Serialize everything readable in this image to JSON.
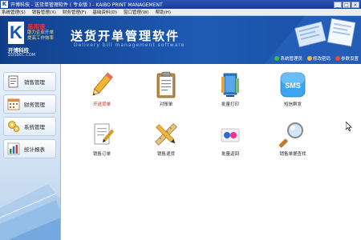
{
  "window": {
    "app_icon": "K",
    "title": "开博科技 - 送货单管理软件 ( 专业版 ) - KAIBO PRINT MANAGEMENT",
    "buttons": [
      "_",
      "□",
      "×"
    ]
  },
  "menubar": [
    "系统管理(S)",
    "销售管理(X)",
    "财务管理(F)",
    "基础资料(D)",
    "窗口管理(W)",
    "帮助(H)"
  ],
  "banner": {
    "logo_letter": "K",
    "brand_red": "易用速",
    "slogan_1": "助力企业开单",
    "slogan_2": "提高工作效率",
    "company": "开博科技",
    "site": "ZOSBEC.COM",
    "main_title": "送货开单管理软件",
    "sub_title": "Delivery bill management software",
    "links": [
      {
        "label": "系统管理员",
        "icon": "user-icon",
        "color": "#2fbf4a"
      },
      {
        "label": "修改密码",
        "icon": "key-icon",
        "color": "#f2b630"
      },
      {
        "label": "参数设置",
        "icon": "settings-icon",
        "color": "#e94b3c"
      }
    ]
  },
  "sidebar": {
    "items": [
      {
        "label": "销售管理",
        "icon": "document-icon"
      },
      {
        "label": "财务管理",
        "icon": "calendar-icon"
      },
      {
        "label": "系统管理",
        "icon": "gears-icon"
      },
      {
        "label": "统计报表",
        "icon": "bar-chart-icon"
      }
    ]
  },
  "tiles": [
    {
      "label": "开送货单",
      "icon": "pencil-icon",
      "highlight": true
    },
    {
      "label": "对账单",
      "icon": "clipboard-icon",
      "highlight": false
    },
    {
      "label": "批量打印",
      "icon": "print-icon",
      "highlight": false
    },
    {
      "label": "短信群发",
      "icon": "sms-icon",
      "highlight": false
    },
    {
      "label": "销售订单",
      "icon": "order-icon",
      "highlight": false
    },
    {
      "label": "销售退货",
      "icon": "return-icon",
      "highlight": false
    },
    {
      "label": "批量返回",
      "icon": "batch-return-icon",
      "highlight": false
    },
    {
      "label": "销售单据查找",
      "icon": "search-icon",
      "highlight": false
    }
  ]
}
